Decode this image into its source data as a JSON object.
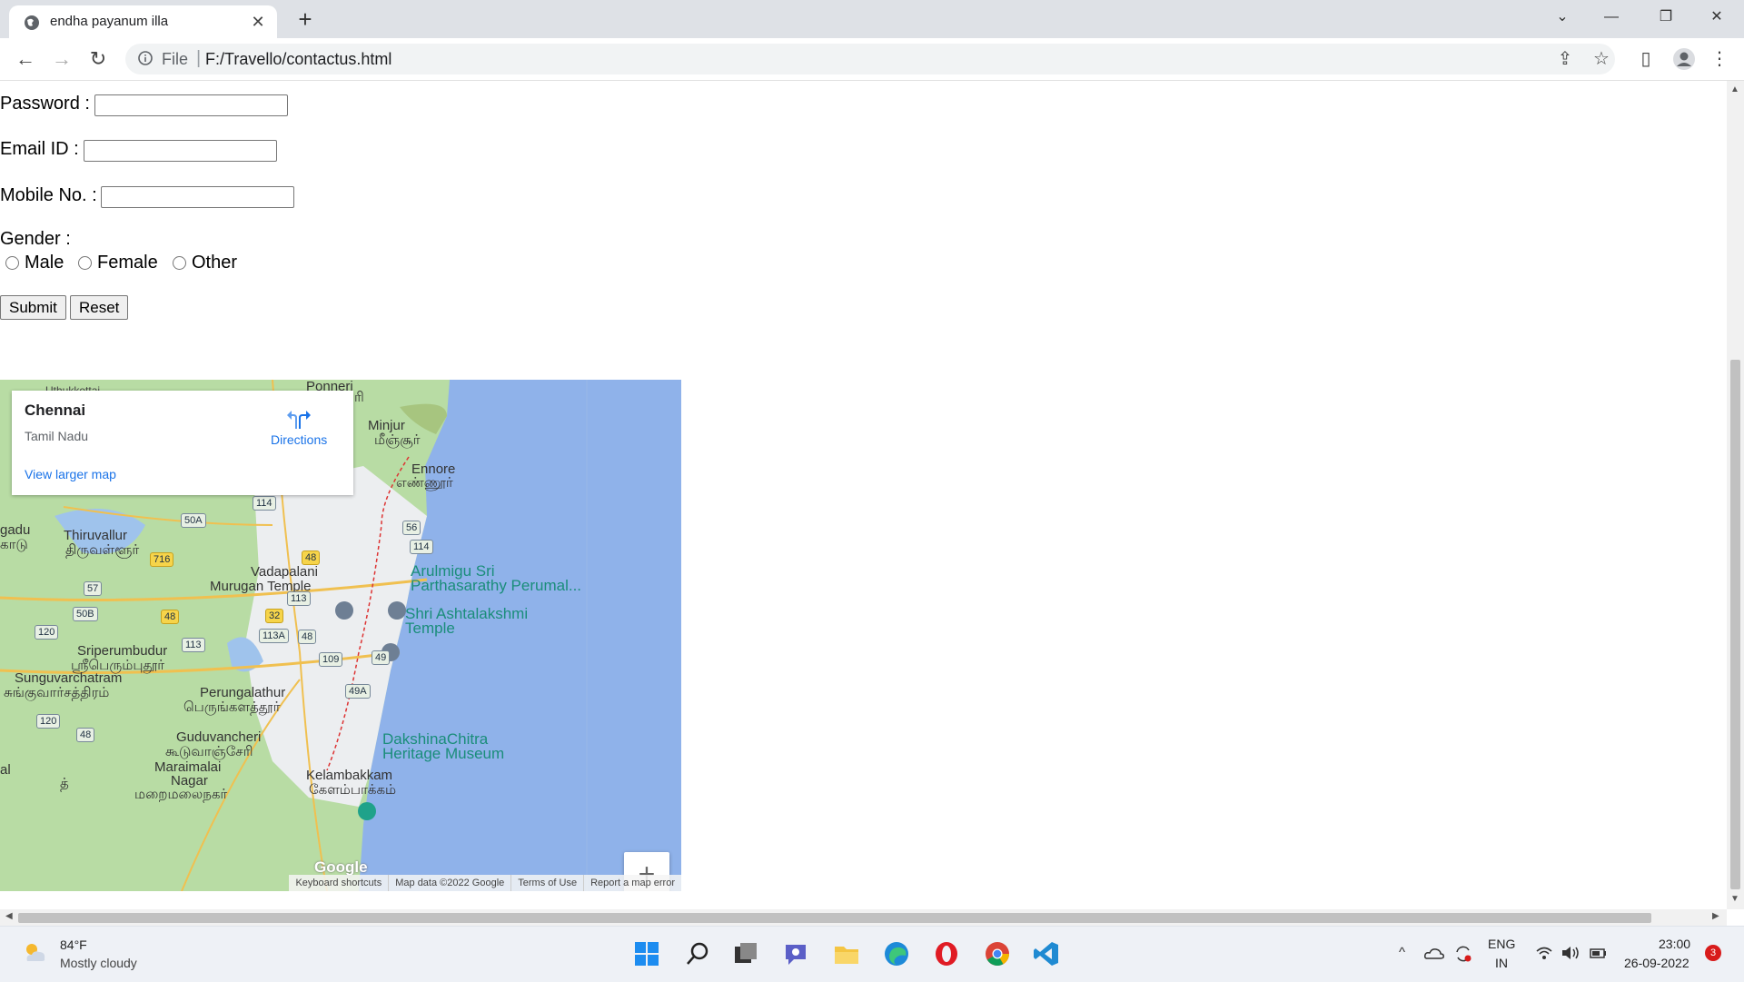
{
  "browser": {
    "tab_title": "endha payanum illa",
    "tab_close": "✕",
    "new_tab": "+",
    "scheme_label": "File",
    "separator": "|",
    "url": "F:/Travello/contactus.html",
    "window_controls": {
      "collapse": "⌄",
      "minimize": "—",
      "restore": "❐",
      "close": "✕"
    },
    "nav": {
      "back": "←",
      "forward": "→",
      "reload": "↻"
    },
    "toolbar_icons": {
      "share": "⇪",
      "bookmark": "☆",
      "sidepanel": "▯",
      "menu": "⋮"
    }
  },
  "form": {
    "password_label": "Password :",
    "email_label": "Email ID :",
    "mobile_label": "Mobile No. :",
    "gender_label": "Gender :",
    "gender_options": [
      "Male",
      "Female",
      "Other"
    ],
    "submit_label": "Submit",
    "reset_label": "Reset",
    "password_value": "",
    "email_value": "",
    "mobile_value": ""
  },
  "map": {
    "place_name": "Chennai",
    "region": "Tamil Nadu",
    "directions_label": "Directions",
    "view_larger": "View larger map",
    "zoom_in": "+",
    "zoom_out": "−",
    "google_logo": "Google",
    "attribution": [
      "Keyboard shortcuts",
      "Map data ©2022 Google",
      "Terms of Use",
      "Report a map error"
    ],
    "labels": {
      "ponneri": "Ponneri",
      "ponneri_ta": "ரி",
      "minjur": "Minjur",
      "minjur_ta": "மீஞ்சூர்",
      "ennore": "Ennore",
      "ennore_ta": "எண்ணூர்",
      "thiruvallur": "Thiruvallur",
      "thiruvallur_ta": "திருவள்ளூர்",
      "gadu": "gadu",
      "gadu_ta": "காடு",
      "uthukottai": "Uthukkottai",
      "vadapalani": "Vadapalani",
      "murugan": "Murugan Temple",
      "arulmigu": "Arulmigu Sri",
      "parthasarathy": "Parthasarathy Perumal...",
      "ashtalakshmi": "Shri Ashtalakshmi",
      "temple": "Temple",
      "sriperumbudur": "Sriperumbudur",
      "sriperumbudur_ta": "ஸ்ரீபெரும்புதூர்",
      "sunguvar": "Sunguvarchatram",
      "sunguvar_ta": "சுங்குவார்சத்திரம்",
      "perungalathur": "Perungalathur",
      "perungalathur_ta": "பெருங்களத்தூர்",
      "dakshina": "DakshinaChitra",
      "heritage": "Heritage Museum",
      "guduvancheri": "Guduvancheri",
      "guduvancheri_ta": "கூடுவாஞ்சேரி",
      "maraimalai": "Maraimalai",
      "nagar": "Nagar",
      "maraimalai_ta": "மறைமலைநகர்",
      "kelambakkam": "Kelambakkam",
      "kelambakkam_ta": "கேளம்பாக்கம்",
      "al": "al",
      "th": "த்"
    },
    "shields": [
      "114",
      "50A",
      "56",
      "114",
      "716",
      "48",
      "57",
      "113",
      "50B",
      "48",
      "32",
      "120",
      "113",
      "113A",
      "48",
      "109",
      "49",
      "49A",
      "120",
      "48"
    ]
  },
  "taskbar": {
    "temperature": "84°F",
    "weather": "Mostly cloudy",
    "lang_line1": "ENG",
    "lang_line2": "IN",
    "time": "23:00",
    "date": "26-09-2022",
    "notification_count": "3"
  },
  "colors": {
    "sea": "#8fb2ea",
    "land": "#b8dca4",
    "city": "#eceef0",
    "accent": "#1a73e8"
  }
}
